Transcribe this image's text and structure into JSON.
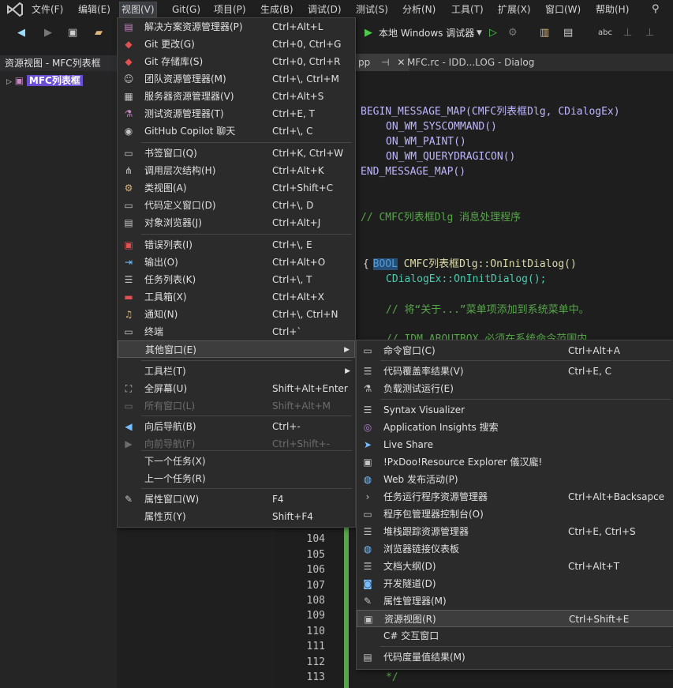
{
  "menubar": {
    "items": [
      "文件(F)",
      "编辑(E)",
      "视图(V)",
      "Git(G)",
      "项目(P)",
      "生成(B)",
      "调试(D)",
      "测试(S)",
      "分析(N)",
      "工具(T)",
      "扩展(X)",
      "窗口(W)",
      "帮助(H)"
    ],
    "active": "视图(V)"
  },
  "toolbar": {
    "run_label": "本地 Windows 调试器"
  },
  "resource_view": {
    "title": "资源视图 - MFC列表框",
    "root": "MFC列表框"
  },
  "doc_tabs": {
    "tab1": "pp",
    "tab2": "MFC.rc - IDD...LOG - Dialog"
  },
  "code": {
    "l1": "BEGIN_MESSAGE_MAP(CMFC列表框Dlg, CDialogEx)",
    "l2": "ON_WM_SYSCOMMAND()",
    "l3": "ON_WM_PAINT()",
    "l4": "ON_WM_QUERYDRAGICON()",
    "l5": "END_MESSAGE_MAP()",
    "l6": "// CMFC列表框Dlg 消息处理程序",
    "l7_kw": "BOOL",
    "l7_rest": "CMFC列表框Dlg::OnInitDialog()",
    "l8": "{",
    "l9": "CDialogEx::OnInitDialog();",
    "l10": "// 将“关于...”菜单项添加到系统菜单中。",
    "l11": "// IDM_ABOUTBOX 必须在系统命令范围内。",
    "l12": "*/",
    "line_numbers": [
      "104",
      "105",
      "106",
      "107",
      "108",
      "109",
      "110",
      "111",
      "112",
      "113"
    ]
  },
  "view_menu": [
    {
      "icon": "solution-explorer-icon",
      "glyph": "▤",
      "label": "解决方案资源管理器(P)",
      "shortcut": "Ctrl+Alt+L"
    },
    {
      "icon": "git-changes-icon",
      "glyph": "◆",
      "label": "Git 更改(G)",
      "shortcut": "Ctrl+0, Ctrl+G"
    },
    {
      "icon": "git-repository-icon",
      "glyph": "◆",
      "label": "Git 存储库(S)",
      "shortcut": "Ctrl+0, Ctrl+R"
    },
    {
      "icon": "team-explorer-icon",
      "glyph": "☺",
      "label": "团队资源管理器(M)",
      "shortcut": "Ctrl+\\, Ctrl+M"
    },
    {
      "icon": "server-explorer-icon",
      "glyph": "▦",
      "label": "服务器资源管理器(V)",
      "shortcut": "Ctrl+Alt+S"
    },
    {
      "icon": "test-explorer-icon",
      "glyph": "⚗",
      "label": "测试资源管理器(T)",
      "shortcut": "Ctrl+E, T"
    },
    {
      "icon": "copilot-icon",
      "glyph": "◉",
      "label": "GitHub Copilot 聊天",
      "shortcut": "Ctrl+\\, C"
    },
    {
      "icon": "bookmark-icon",
      "glyph": "▭",
      "label": "书签窗口(Q)",
      "shortcut": "Ctrl+K, Ctrl+W"
    },
    {
      "icon": "call-hierarchy-icon",
      "glyph": "⋔",
      "label": "调用层次结构(H)",
      "shortcut": "Ctrl+Alt+K"
    },
    {
      "icon": "class-view-icon",
      "glyph": "⚙",
      "label": "类视图(A)",
      "shortcut": "Ctrl+Shift+C"
    },
    {
      "icon": "code-definition-icon",
      "glyph": "▭",
      "label": "代码定义窗口(D)",
      "shortcut": "Ctrl+\\, D"
    },
    {
      "icon": "object-browser-icon",
      "glyph": "▤",
      "label": "对象浏览器(J)",
      "shortcut": "Ctrl+Alt+J"
    },
    {
      "icon": "error-list-icon",
      "glyph": "▣",
      "label": "错误列表(I)",
      "shortcut": "Ctrl+\\, E"
    },
    {
      "icon": "output-icon",
      "glyph": "⇥",
      "label": "输出(O)",
      "shortcut": "Ctrl+Alt+O"
    },
    {
      "icon": "task-list-icon",
      "glyph": "☰",
      "label": "任务列表(K)",
      "shortcut": "Ctrl+\\, T"
    },
    {
      "icon": "toolbox-icon",
      "glyph": "▬",
      "label": "工具箱(X)",
      "shortcut": "Ctrl+Alt+X"
    },
    {
      "icon": "notifications-icon",
      "glyph": "♫",
      "label": "通知(N)",
      "shortcut": "Ctrl+\\, Ctrl+N"
    },
    {
      "icon": "terminal-icon",
      "glyph": "▭",
      "label": "终端",
      "shortcut": "Ctrl+`"
    },
    {
      "label": "其他窗口(E)",
      "shortcut": ""
    },
    {
      "label": "工具栏(T)",
      "shortcut": ""
    },
    {
      "icon": "fullscreen-icon",
      "glyph": "⛶",
      "label": "全屏幕(U)",
      "shortcut": "Shift+Alt+Enter"
    },
    {
      "icon": "all-windows-icon",
      "glyph": "▭",
      "label": "所有窗口(L)",
      "shortcut": "Shift+Alt+M"
    },
    {
      "icon": "navigate-back-icon",
      "glyph": "◀",
      "label": "向后导航(B)",
      "shortcut": "Ctrl+-"
    },
    {
      "icon": "navigate-forward-icon",
      "glyph": "▶",
      "label": "向前导航(F)",
      "shortcut": "Ctrl+Shift+-"
    },
    {
      "label": "下一个任务(X)",
      "shortcut": ""
    },
    {
      "label": "上一个任务(R)",
      "shortcut": ""
    },
    {
      "icon": "properties-window-icon",
      "glyph": "✎",
      "label": "属性窗口(W)",
      "shortcut": "F4"
    },
    {
      "label": "属性页(Y)",
      "shortcut": "Shift+F4"
    }
  ],
  "other_windows_menu": [
    {
      "icon": "command-window-icon",
      "glyph": "▭",
      "label": "命令窗口(C)",
      "shortcut": "Ctrl+Alt+A"
    },
    {
      "icon": "code-coverage-icon",
      "glyph": "☰",
      "label": "代码覆盖率结果(V)",
      "shortcut": "Ctrl+E, C"
    },
    {
      "icon": "load-test-icon",
      "glyph": "⚗",
      "label": "负载测试运行(E)",
      "shortcut": ""
    },
    {
      "icon": "syntax-visualizer-icon",
      "glyph": "☰",
      "label": "Syntax Visualizer",
      "shortcut": ""
    },
    {
      "icon": "app-insights-icon",
      "glyph": "◎",
      "label": "Application Insights 搜索",
      "shortcut": ""
    },
    {
      "icon": "live-share-icon",
      "glyph": "➤",
      "label": "Live Share",
      "shortcut": ""
    },
    {
      "icon": "resource-explorer-icon",
      "glyph": "▣",
      "label": "!PxDoo!Resource Explorer 儀汉龐!",
      "shortcut": ""
    },
    {
      "icon": "web-publish-icon",
      "glyph": "◍",
      "label": "Web 发布活动(P)",
      "shortcut": ""
    },
    {
      "icon": "task-runner-icon",
      "glyph": "›",
      "label": "任务运行程序资源管理器",
      "shortcut": "Ctrl+Alt+Backsapce"
    },
    {
      "icon": "package-manager-icon",
      "glyph": "▭",
      "label": "程序包管理器控制台(O)",
      "shortcut": ""
    },
    {
      "icon": "stack-trace-icon",
      "glyph": "☰",
      "label": "堆栈跟踪资源管理器",
      "shortcut": "Ctrl+E, Ctrl+S"
    },
    {
      "icon": "browser-link-icon",
      "glyph": "◍",
      "label": "浏览器链接仪表板",
      "shortcut": ""
    },
    {
      "icon": "document-outline-icon",
      "glyph": "☰",
      "label": "文档大纲(D)",
      "shortcut": "Ctrl+Alt+T"
    },
    {
      "icon": "dev-tunnels-icon",
      "glyph": "◙",
      "label": "开发隧道(D)",
      "shortcut": ""
    },
    {
      "icon": "property-manager-icon",
      "glyph": "✎",
      "label": "属性管理器(M)",
      "shortcut": ""
    },
    {
      "icon": "resource-view-icon",
      "glyph": "▣",
      "label": "资源视图(R)",
      "shortcut": "Ctrl+Shift+E"
    },
    {
      "label": "C# 交互窗口",
      "shortcut": ""
    },
    {
      "icon": "code-metrics-icon",
      "glyph": "▤",
      "label": "代码度量值结果(M)",
      "shortcut": ""
    }
  ]
}
